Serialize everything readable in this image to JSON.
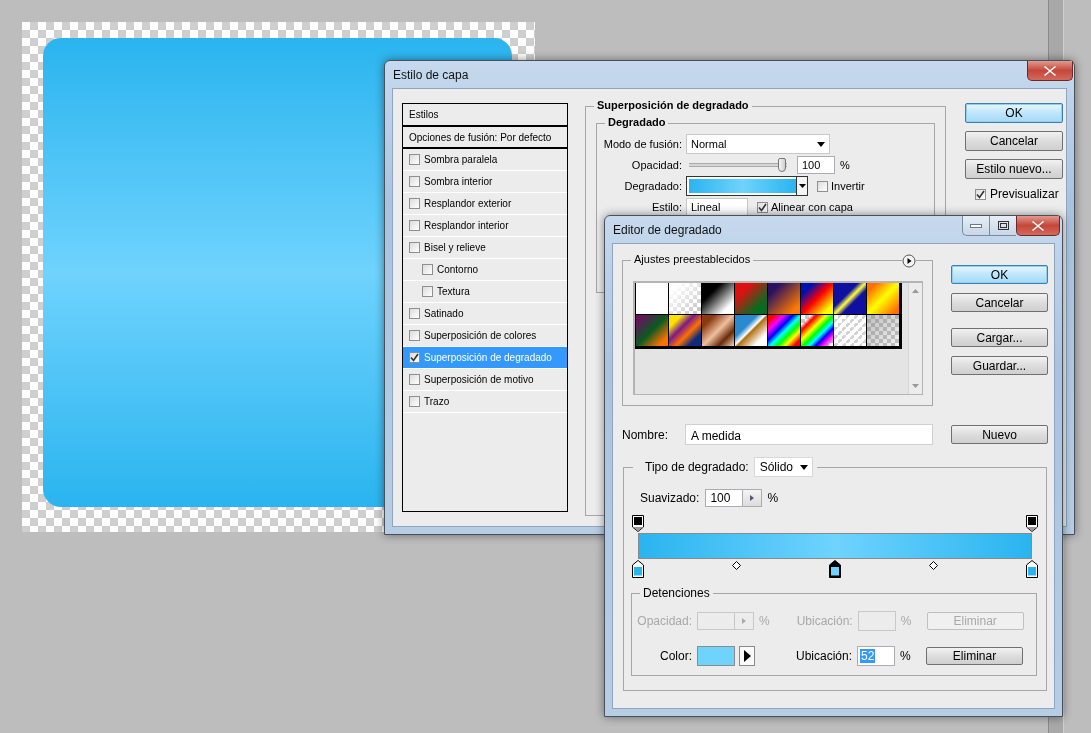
{
  "layer_style": {
    "title": "Estilo de capa",
    "styles_header": "Estilos",
    "blend_options": "Opciones de fusión: Por defecto",
    "effects": [
      {
        "label": "Sombra paralela",
        "checked": false,
        "selected": false
      },
      {
        "label": "Sombra interior",
        "checked": false,
        "selected": false
      },
      {
        "label": "Resplandor exterior",
        "checked": false,
        "selected": false
      },
      {
        "label": "Resplandor interior",
        "checked": false,
        "selected": false
      },
      {
        "label": "Bisel y relieve",
        "checked": false,
        "selected": false,
        "children": [
          {
            "label": "Contorno",
            "checked": false,
            "selected": false
          },
          {
            "label": "Textura",
            "checked": false,
            "selected": false
          }
        ]
      },
      {
        "label": "Satinado",
        "checked": false,
        "selected": false
      },
      {
        "label": "Superposición de colores",
        "checked": false,
        "selected": false
      },
      {
        "label": "Superposición de degradado",
        "checked": true,
        "selected": true
      },
      {
        "label": "Superposición de motivo",
        "checked": false,
        "selected": false
      },
      {
        "label": "Trazo",
        "checked": false,
        "selected": false
      }
    ],
    "section_title": "Superposición de degradado",
    "group_title": "Degradado",
    "blend_mode": {
      "label": "Modo de fusión:",
      "value": "Normal"
    },
    "opacity": {
      "label": "Opacidad:",
      "level": 1,
      "value": "100",
      "unit": "%"
    },
    "gradient": {
      "label": "Degradado:"
    },
    "reverse": {
      "label": "Invertir",
      "checked": false
    },
    "style": {
      "label": "Estilo:",
      "value": "Lineal"
    },
    "align": {
      "label": "Alinear con capa",
      "checked": true
    },
    "buttons": [
      {
        "label": "OK",
        "default": true
      },
      {
        "label": "Cancelar",
        "default": false
      },
      {
        "label": "Estilo nuevo...",
        "default": false
      }
    ],
    "preview": {
      "label": "Previsualizar",
      "checked": true
    }
  },
  "gradient_editor": {
    "title": "Editor de degradado",
    "presets_title": "Ajustes preestablecidos",
    "buttons": [
      {
        "label": "OK",
        "default": true
      },
      {
        "label": "Cancelar",
        "default": false
      },
      {
        "label": "Cargar...",
        "default": false
      },
      {
        "label": "Guardar...",
        "default": false
      }
    ],
    "name": {
      "label": "Nombre:",
      "value": "A medida"
    },
    "new_button": "Nuevo",
    "type": {
      "label": "Tipo de degradado:",
      "value": "Sólido"
    },
    "smoothness": {
      "label": "Suavizado:",
      "value": "100",
      "unit": "%"
    },
    "opacity_stops": [
      {
        "selected": false
      },
      {
        "selected": false
      }
    ],
    "color_stops": [
      {
        "color": "#2ab4ef",
        "selected": false
      },
      {
        "color": "#6fd3fd",
        "selected": true
      },
      {
        "color": "#2ab4ef",
        "selected": false
      }
    ],
    "stops_title": "Detenciones",
    "stop_rows": [
      {
        "kind": "opacity",
        "disabled": true,
        "label": "Opacidad:",
        "unit": "%",
        "location_label": "Ubicación:",
        "location_unit": "%",
        "delete": "Eliminar"
      },
      {
        "kind": "color",
        "disabled": false,
        "label": "Color:",
        "color": "#6fd3fd",
        "location_label": "Ubicación:",
        "location_value": "52",
        "location_unit": "%",
        "delete": "Eliminar"
      }
    ]
  }
}
